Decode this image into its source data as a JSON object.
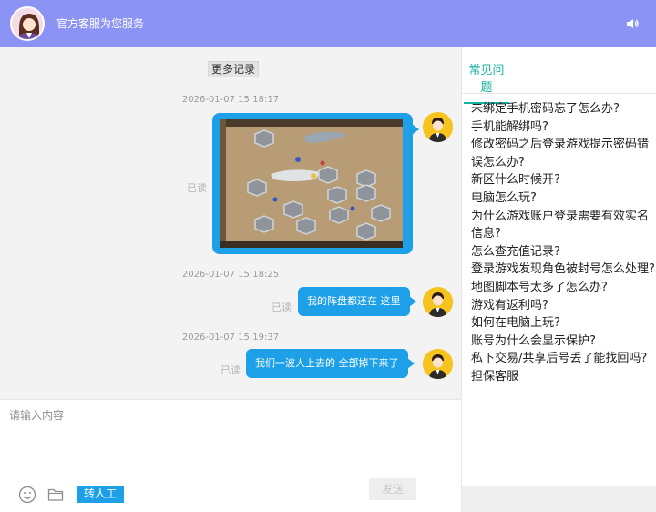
{
  "header": {
    "title": "官方客服为您服务",
    "background": "#8b93f5",
    "sound_icon": "speaker-icon"
  },
  "chat": {
    "more_history": "更多记录",
    "messages": [
      {
        "time": "2026-01-07 15:18:17",
        "type": "image",
        "status": "已读",
        "image": "game-screenshot"
      },
      {
        "time": "2026-01-07 15:18:25",
        "type": "text",
        "status": "已读",
        "text": "我的阵盘都还在 这里"
      },
      {
        "time": "2026-01-07 15:19:37",
        "type": "text",
        "status": "已读",
        "text": "我们一波人上去的 全部掉下来了"
      }
    ],
    "bubble_color": "#1ea0e8"
  },
  "input": {
    "placeholder": "请输入内容",
    "transfer_label": "转人工",
    "send_label": "发送",
    "emoji_icon": "emoji-icon",
    "folder_icon": "folder-icon"
  },
  "faq": {
    "tab_label": "常见问题",
    "accent": "#16b3a3",
    "items": [
      "未绑定手机密码忘了怎么办?",
      "手机能解绑吗?",
      "修改密码之后登录游戏提示密码错误怎么办?",
      "新区什么时候开?",
      "电脑怎么玩?",
      "为什么游戏账户登录需要有效实名信息?",
      "怎么查充值记录?",
      "登录游戏发现角色被封号怎么处理?",
      "地图脚本号太多了怎么办?",
      "游戏有返利吗?",
      "如何在电脑上玩?",
      "账号为什么会显示保护?",
      "私下交易/共享后号丢了能找回吗?",
      "担保客服"
    ]
  }
}
